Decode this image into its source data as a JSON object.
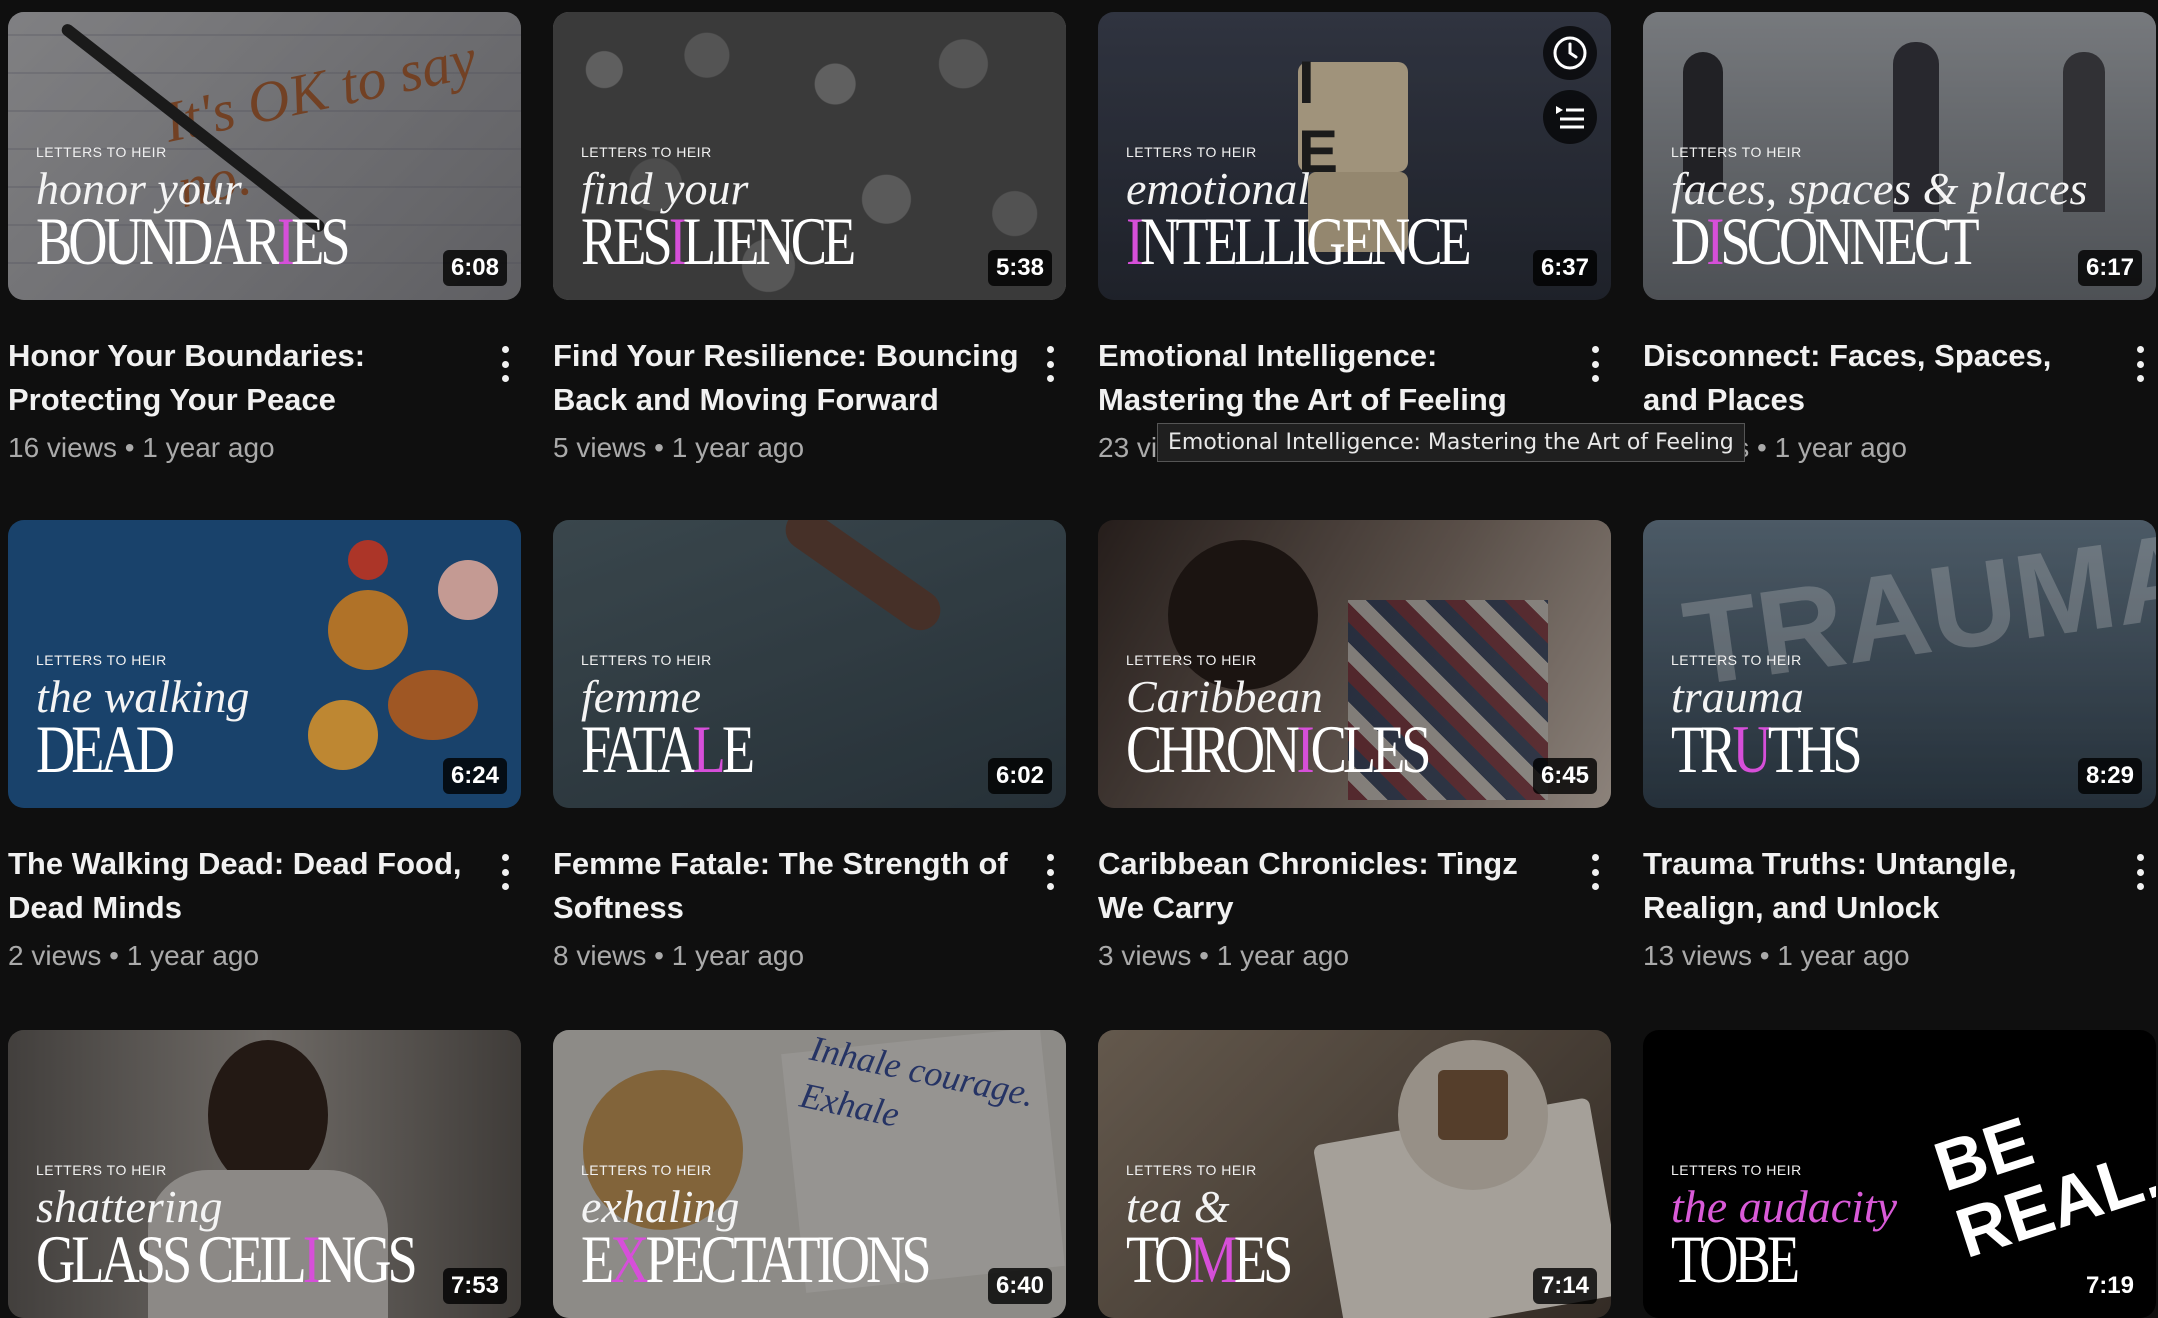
{
  "brand_label": "LETTERS TO HEIR",
  "tooltip": "Emotional Intelligence: Mastering the Art of Feeling",
  "videos": [
    {
      "title": "Honor Your Boundaries: Protecting Your Peace",
      "meta": "16 views • 1 year ago",
      "duration": "6:08",
      "script": "honor your",
      "big_a": "BOUNDAR",
      "big_accent": "I",
      "big_b": "ES",
      "handwriting": "It's OK to say no."
    },
    {
      "title": "Find Your Resilience: Bouncing Back and Moving Forward",
      "meta": "5 views • 1 year ago",
      "duration": "5:38",
      "script": "find your",
      "big_a": "RES",
      "big_accent": "I",
      "big_b": "LIENCE"
    },
    {
      "title": "Emotional Intelligence: Mastering the Art of Feeling",
      "meta": "23 vi",
      "duration": "6:37",
      "script": "emotional",
      "big_a": "",
      "big_accent": "I",
      "big_b": "NTELLIGENCE",
      "cube_letters": "I E"
    },
    {
      "title": "Disconnect: Faces, Spaces, and Places",
      "meta": "ws • 1 year ago",
      "duration": "6:17",
      "script": "faces, spaces & places",
      "big_a": "D",
      "big_accent": "I",
      "big_b": "SCONNECT"
    },
    {
      "title": "The Walking Dead: Dead Food, Dead Minds",
      "meta": "2 views • 1 year ago",
      "duration": "6:24",
      "script": "the walking",
      "big_a": "DEAD",
      "big_accent": "",
      "big_b": ""
    },
    {
      "title": "Femme Fatale: The Strength of Softness",
      "meta": "8 views • 1 year ago",
      "duration": "6:02",
      "script": "femme",
      "big_a": "FATA",
      "big_accent": "L",
      "big_b": "E"
    },
    {
      "title": "Caribbean Chronicles: Tingz We Carry",
      "meta": "3 views • 1 year ago",
      "duration": "6:45",
      "script": "Caribbean",
      "big_a": "CHRON",
      "big_accent": "I",
      "big_b": "CLES"
    },
    {
      "title": "Trauma Truths: Untangle, Realign, and Unlock",
      "meta": "13 views • 1 year ago",
      "duration": "8:29",
      "script": "trauma",
      "big_a": "TR",
      "big_accent": "U",
      "big_b": "THS",
      "background_word": "TRAUMA"
    },
    {
      "title": "",
      "meta": "",
      "duration": "7:53",
      "script": "shattering",
      "big_a": "GLASS CEIL",
      "big_accent": "I",
      "big_b": "NGS"
    },
    {
      "title": "",
      "meta": "",
      "duration": "6:40",
      "script": "exhaling",
      "big_a": "E",
      "big_accent": "X",
      "big_b": "PECTATIONS",
      "handwriting": "Inhale courage. Exhale"
    },
    {
      "title": "",
      "meta": "",
      "duration": "7:14",
      "script": "tea &",
      "big_a": "TO",
      "big_accent": "M",
      "big_b": "ES"
    },
    {
      "title": "",
      "meta": "",
      "duration": "7:19",
      "script": "the audacity",
      "big_a": "TOBE",
      "big_accent": "",
      "big_b": "",
      "side_word_a": "BE",
      "side_word_b": "REAL."
    }
  ],
  "icons": {
    "menu": "more-vert-icon",
    "watch_later": "clock-icon",
    "add_to_queue": "queue-icon"
  }
}
